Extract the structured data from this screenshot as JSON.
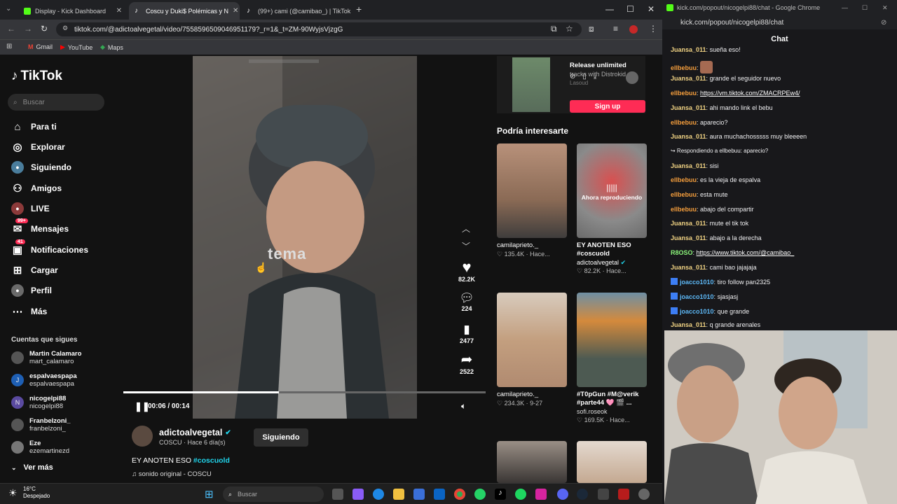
{
  "browser": {
    "tabs": [
      {
        "title": "Display - Kick Dashboard",
        "favicon": "kick-icon"
      },
      {
        "title": "Coscu y Duki$ Polémicas y N",
        "favicon": "tiktok-icon",
        "active": true
      },
      {
        "title": "(99+) cami (@camibao_) | TikTok",
        "favicon": "tiktok-icon"
      }
    ],
    "url": "tiktok.com/@adictoalvegetal/video/7558596509046951179?_r=1&_t=ZM-90WyjsVjzgG",
    "bookmarks": [
      "Gmail",
      "YouTube",
      "Maps"
    ]
  },
  "tiktok": {
    "logo": "TikTok",
    "search_placeholder": "Buscar",
    "nav": [
      {
        "label": "Para ti",
        "icon": "home-icon"
      },
      {
        "label": "Explorar",
        "icon": "compass-icon"
      },
      {
        "label": "Siguiendo",
        "icon": "following-avatar-icon"
      },
      {
        "label": "Amigos",
        "icon": "friends-icon"
      },
      {
        "label": "LIVE",
        "icon": "live-icon"
      },
      {
        "label": "Mensajes",
        "icon": "messages-icon",
        "badge": "99+"
      },
      {
        "label": "Notificaciones",
        "icon": "notifications-icon",
        "badge": "41"
      },
      {
        "label": "Cargar",
        "icon": "upload-icon"
      },
      {
        "label": "Perfil",
        "icon": "profile-icon"
      },
      {
        "label": "Más",
        "icon": "more-icon"
      }
    ],
    "following_title": "Cuentas que sigues",
    "following": [
      {
        "name": "Martin Calamaro",
        "handle": "mart_calamaro"
      },
      {
        "name": "espalvaespapa",
        "handle": "espalvaespapa"
      },
      {
        "name": "nicogelpi88",
        "handle": "nicogelpi88"
      },
      {
        "name": "Franbelzoni_",
        "handle": "franbelzoni_"
      },
      {
        "name": "Eze",
        "handle": "ezemartinezd"
      }
    ],
    "see_more": "Ver más",
    "video": {
      "overlay_text": "tema",
      "time": "00:06 / 00:14",
      "progress": 0.43,
      "likes": "82.2K",
      "comments": "224",
      "saves": "2477",
      "shares": "2522"
    },
    "author": {
      "handle": "adictoalvegetal",
      "sub": "COSCU · Hace 6 día(s)",
      "follow_label": "Siguiendo",
      "caption": "EY ANOTEN ESO",
      "hashtag": "#coscuold",
      "sound": "sonido original - COSCU"
    },
    "promo": {
      "title": "Release unlimited",
      "sub1": "tracks with Distrokid",
      "sub2": "Lasoud",
      "signup": "Sign up"
    },
    "recommend_title": "Podría interesarte",
    "cards": [
      {
        "title": "camilaprieto._",
        "meta": "♡ 135.4K · Hace..."
      },
      {
        "title": "EY ANOTEN ESO #coscuold",
        "author": "adictoalvegetal",
        "meta": "♡ 82.2K · Hace...",
        "overlay": "Ahora reproduciendo"
      },
      {
        "title": "camilaprieto._",
        "meta": "♡ 234.3K · 9-27"
      },
      {
        "title": "#T0pGun #M@verik #parte44 🩷 🎬 ...",
        "author": "sofi.roseok",
        "meta": "♡ 169.5K · Hace..."
      }
    ]
  },
  "taskbar": {
    "weather_temp": "16°C",
    "weather_desc": "Despejado",
    "search_placeholder": "Buscar"
  },
  "chat": {
    "window_title": "kick.com/popout/nicogelpi88/chat - Google Chrome",
    "url": "kick.com/popout/nicogelpi88/chat",
    "title": "Chat",
    "messages": [
      {
        "user": "Juansa_011",
        "text": "sueña eso!",
        "color": "#f0d283"
      },
      {
        "user": "ellbebuu",
        "text": "",
        "color": "#f59e3c",
        "sticker": true
      },
      {
        "user": "Juansa_011",
        "text": "grande el seguidor nuevo",
        "color": "#f0d283"
      },
      {
        "user": "ellbebuu",
        "text": "https://vm.tiktok.com/ZMACRPEw4/",
        "color": "#f59e3c",
        "link": true
      },
      {
        "user": "Juansa_011",
        "text": "ahi mando link el bebu",
        "color": "#f0d283"
      },
      {
        "user": "ellbebuu",
        "text": "aparecio?",
        "color": "#f59e3c"
      },
      {
        "user": "Juansa_011",
        "text": "aura muchachosssss muy bleeeen",
        "color": "#f0d283"
      },
      {
        "user": "",
        "text": "↪ Respondiendo a ellbebuu: aparecio?",
        "color": "#9a9aa0",
        "reply": true
      },
      {
        "user": "Juansa_011",
        "text": "sisi",
        "color": "#f0d283"
      },
      {
        "user": "ellbebuu",
        "text": "es la vieja de espalva",
        "color": "#f59e3c"
      },
      {
        "user": "ellbebuu",
        "text": "esta mute",
        "color": "#f59e3c"
      },
      {
        "user": "ellbebuu",
        "text": "abajo del compartir",
        "color": "#f59e3c"
      },
      {
        "user": "Juansa_011",
        "text": "mute el tik tok",
        "color": "#f0d283"
      },
      {
        "user": "Juansa_011",
        "text": "abajo a la derecha",
        "color": "#f0d283"
      },
      {
        "user": "R8OSO",
        "text": "https://www.tiktok.com/@camibao_",
        "color": "#8bf57a",
        "link": true
      },
      {
        "user": "Juansa_011",
        "text": "cami bao jajajaja",
        "color": "#f0d283"
      },
      {
        "user": "joacco1010",
        "text": "tiro follow pan2325",
        "color": "#5cb7f5",
        "badge": true
      },
      {
        "user": "joacco1010",
        "text": "sjasjasj",
        "color": "#5cb7f5",
        "badge": true
      },
      {
        "user": "joacco1010",
        "text": "que grande",
        "color": "#5cb7f5",
        "badge": true
      },
      {
        "user": "Juansa_011",
        "text": "q grande arenales",
        "color": "#f0d283"
      }
    ]
  },
  "colors": {
    "accent": "#fe2c55",
    "kick": "#53fc18",
    "link": "#20d5ec"
  }
}
